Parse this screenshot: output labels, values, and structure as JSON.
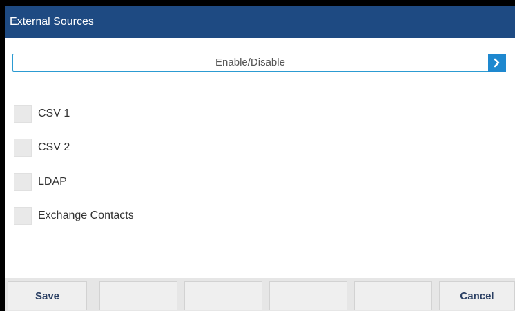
{
  "title_bar": {
    "title": "External Sources"
  },
  "header_field": {
    "label": "Enable/Disable",
    "arrow_icon": "chevron-right-icon"
  },
  "options": [
    {
      "label": "CSV 1",
      "checked": false
    },
    {
      "label": "CSV 2",
      "checked": false
    },
    {
      "label": "LDAP",
      "checked": false
    },
    {
      "label": "Exchange Contacts",
      "checked": false
    }
  ],
  "softkeys": [
    {
      "label": "Save"
    },
    {
      "label": ""
    },
    {
      "label": ""
    },
    {
      "label": ""
    },
    {
      "label": ""
    },
    {
      "label": "Cancel"
    }
  ],
  "colors": {
    "title_bar_bg": "#1e4a82",
    "accent_blue": "#1e88cf",
    "softkey_text": "#2a3f63"
  }
}
